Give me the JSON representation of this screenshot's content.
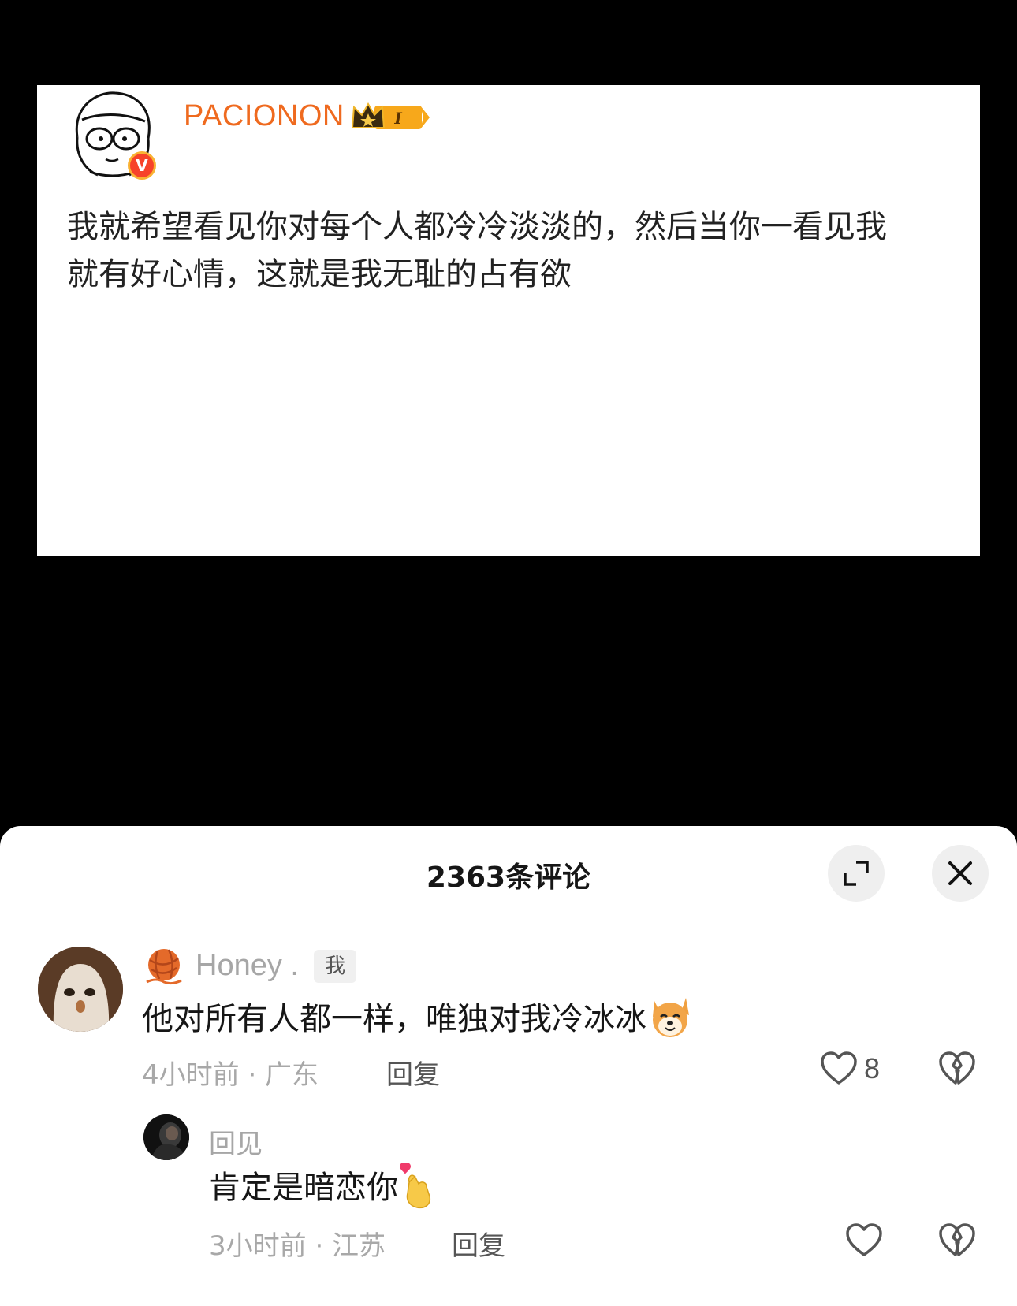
{
  "post": {
    "author_name": "PACIONON",
    "verified_mark": "V",
    "level_badge": "I",
    "text": "我就希望看见你对每个人都冷冷淡淡的，然后当你一看见我就有好心情，这就是我无耻的占有欲"
  },
  "comments_panel": {
    "title": "2363条评论",
    "expand_icon": "expand-icon",
    "close_icon": "close-icon"
  },
  "comments": [
    {
      "username": "Honey .",
      "badge": "我",
      "text": "他对所有人都一样，唯独对我冷冰冰",
      "emoji": "dog-face-emoji",
      "meta": "4小时前 · 广东",
      "reply_label": "回复",
      "like_count": "8"
    },
    {
      "username": "回见",
      "text": "肯定是暗恋你",
      "emoji": "finger-heart-emoji",
      "meta": "3小时前 · 江苏",
      "reply_label": "回复"
    }
  ]
}
